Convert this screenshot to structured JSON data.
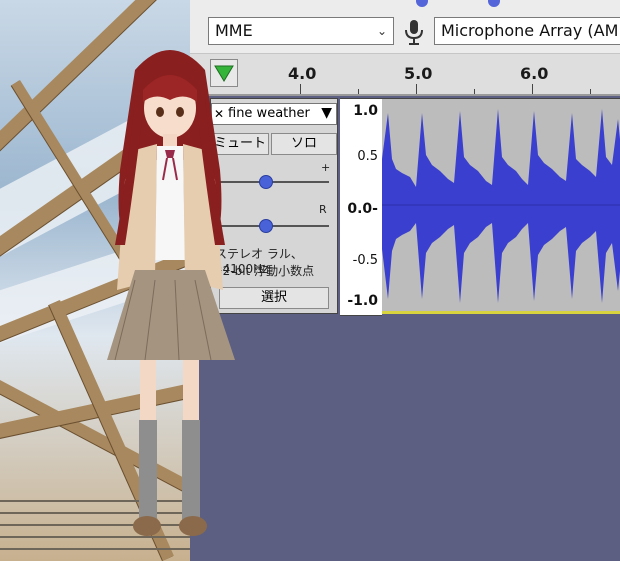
{
  "toolbar": {
    "host_label": "MME",
    "input_device_label": "Microphone Array (AM",
    "mic_icon": "microphone-icon",
    "dropdown_icon": "chevron-down-icon"
  },
  "ruler": {
    "ticks": [
      "4.0",
      "5.0",
      "6.0"
    ],
    "play_icon": "play-triangle-icon"
  },
  "track": {
    "name": "fine weather",
    "mute_label": "ミュート",
    "solo_label": "ソロ",
    "gain_plus": "+",
    "pan_right": "R",
    "info_line1": "ステレオ ラル、44100Hz",
    "info_line2": "32-bit 浮動小数点",
    "select_label": "選択",
    "scale": [
      "1.0",
      "0.5",
      "0.0-",
      "-0.5",
      "-1.0"
    ]
  },
  "colors": {
    "waveform": "#3a3fcf",
    "accent": "#5464d9",
    "background_app": "#5c5e82"
  }
}
